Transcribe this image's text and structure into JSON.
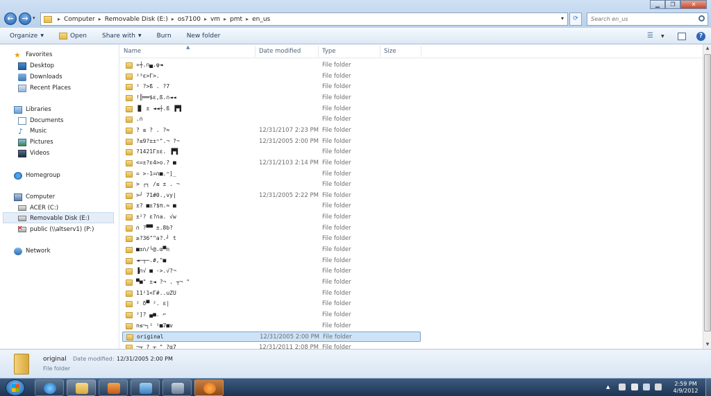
{
  "breadcrumb": [
    "Computer",
    "Removable Disk (E:)",
    "os7100",
    "vm",
    "pmt",
    "en_us"
  ],
  "search": {
    "placeholder": "Search en_us"
  },
  "toolbar": {
    "organize": "Organize",
    "open": "Open",
    "share_with": "Share with",
    "burn": "Burn",
    "new_folder": "New folder"
  },
  "nav": {
    "favorites": "Favorites",
    "desktop": "Desktop",
    "downloads": "Downloads",
    "recent_places": "Recent Places",
    "libraries": "Libraries",
    "documents": "Documents",
    "music": "Music",
    "pictures": "Pictures",
    "videos": "Videos",
    "homegroup": "Homegroup",
    "computer": "Computer",
    "acer": "ACER (C:)",
    "removable": "Removable Disk (E:)",
    "public": "public (\\\\altserv1) (P:)",
    "network": "Network"
  },
  "columns": {
    "name": "Name",
    "date_modified": "Date modified",
    "type": "Type",
    "size": "Size"
  },
  "files": [
    {
      "name": "»┼.∩▄.φ◄",
      "date": "",
      "type": "File folder"
    },
    {
      "name": "²³ε>Γ>.",
      "date": "",
      "type": "File folder"
    },
    {
      "name": "² ?>ß  . ?7",
      "date": "",
      "type": "File folder"
    },
    {
      "name": "!╠══$ε,ß.∩◄◄",
      "date": "",
      "type": "File folder"
    },
    {
      "name": "▐▌ ± ◄◄┼.ß ▐▀▌",
      "date": "",
      "type": "File folder"
    },
    {
      "name": ".∩",
      "date": "",
      "type": "File folder"
    },
    {
      "name": "? ≤  ?  . ?≈",
      "date": "12/31/2107 2:23 PM",
      "type": "File folder"
    },
    {
      "name": "?≤9?±±ⁿ\".¬  ?¬",
      "date": "12/31/2005 2:00 PM",
      "type": "File folder"
    },
    {
      "name": "?1421Γ±ε.  ▐▀▌",
      "date": "",
      "type": "File folder"
    },
    {
      "name": "<=±?ε4>ο.? ■",
      "date": "12/31/2103 2:14 PM",
      "type": "File folder"
    },
    {
      "name": "= >-1=∩■.ⁿ]_",
      "date": "",
      "type": "File folder"
    },
    {
      "name": "> ┌┐ /≤ ± . ¬",
      "date": "",
      "type": "File folder"
    },
    {
      "name": ">┘  71#0.,vy|",
      "date": "12/31/2005 2:22 PM",
      "type": "File folder"
    },
    {
      "name": "±? ■±?$π.≈ ■",
      "date": "",
      "type": "File folder"
    },
    {
      "name": "±²? ε?∩a. √w",
      "date": "",
      "type": "File folder"
    },
    {
      "name": "∩ ?▀▀  ±.8b?",
      "date": "",
      "type": "File folder"
    },
    {
      "name": "≥?36\"\"a?.┘ t",
      "date": "",
      "type": "File folder"
    },
    {
      "name": "■±∩/└@.α▀n",
      "date": "",
      "type": "File folder"
    },
    {
      "name": "◄─┬─.#,\"■",
      "date": "",
      "type": "File folder"
    },
    {
      "name": " ▐∩√ ■  ->.√?¬",
      "date": "",
      "type": "File folder"
    },
    {
      "name": "▀■\"  ±◄ ?¬ . ┬¬ \"",
      "date": "",
      "type": "File folder"
    },
    {
      "name": "11²1<Γ#..uZU",
      "date": "",
      "type": "File folder"
    },
    {
      "name": "² δ▀ ². ε|",
      "date": "",
      "type": "File folder"
    },
    {
      "name": "²]?   ▄■. ⌐",
      "date": "",
      "type": "File folder"
    },
    {
      "name": "n≤¬┐² ²■7■v",
      "date": "",
      "type": "File folder"
    },
    {
      "name": "original",
      "date": "12/31/2005 2:00 PM",
      "type": "File folder"
    },
    {
      "name": "¬┬ ? ┬ \"  ?α7",
      "date": "12/31/2011 2:08 PM",
      "type": "File folder"
    }
  ],
  "selected_index": 25,
  "details": {
    "name": "original",
    "date_label": "Date modified:",
    "date": "12/31/2005 2:00 PM",
    "type": "File folder"
  },
  "clock": {
    "time": "2:59 PM",
    "date": "4/9/2012"
  },
  "colors": {
    "selection": "#cde3f8",
    "taskbar": "#1d3452",
    "accent": "#3267b5"
  }
}
